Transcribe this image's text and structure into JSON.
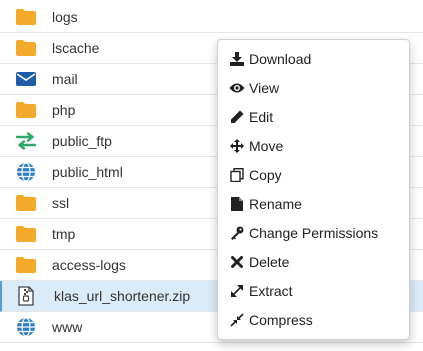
{
  "files": [
    {
      "name": "logs",
      "icon": "folder-icon"
    },
    {
      "name": "lscache",
      "icon": "folder-icon"
    },
    {
      "name": "mail",
      "icon": "envelope-icon"
    },
    {
      "name": "php",
      "icon": "folder-icon"
    },
    {
      "name": "public_ftp",
      "icon": "transfer-arrows-icon"
    },
    {
      "name": "public_html",
      "icon": "globe-icon"
    },
    {
      "name": "ssl",
      "icon": "folder-icon"
    },
    {
      "name": "tmp",
      "icon": "folder-icon"
    },
    {
      "name": "access-logs",
      "icon": "folder-icon"
    },
    {
      "name": "klas_url_shortener.zip",
      "icon": "zip-file-icon",
      "selected": true
    },
    {
      "name": "www",
      "icon": "globe-icon"
    }
  ],
  "context_menu": {
    "items": [
      {
        "label": "Download",
        "icon": "download-icon"
      },
      {
        "label": "View",
        "icon": "eye-icon"
      },
      {
        "label": "Edit",
        "icon": "pencil-icon"
      },
      {
        "label": "Move",
        "icon": "move-arrows-icon"
      },
      {
        "label": "Copy",
        "icon": "copy-icon"
      },
      {
        "label": "Rename",
        "icon": "file-icon"
      },
      {
        "label": "Change Permissions",
        "icon": "key-icon"
      },
      {
        "label": "Delete",
        "icon": "x-icon"
      },
      {
        "label": "Extract",
        "icon": "expand-icon"
      },
      {
        "label": "Compress",
        "icon": "compress-icon"
      }
    ]
  },
  "colors": {
    "folder": "#f3a92a",
    "mail": "#1e5ba8",
    "ftp": "#2da866",
    "globe": "#2f7fc1",
    "selected_row": "#dcebf8"
  }
}
